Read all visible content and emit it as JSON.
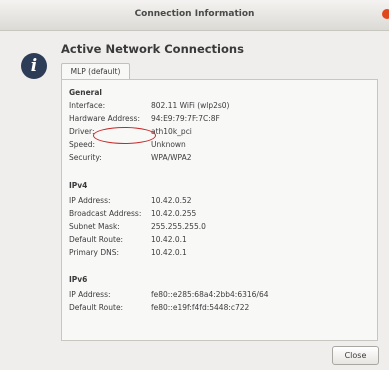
{
  "window": {
    "title": "Connection Information"
  },
  "heading": "Active Network Connections",
  "tab_label": "MLP (default)",
  "general": {
    "title": "General",
    "rows": [
      {
        "key": "Interface:",
        "value": "802.11 WiFi (wlp2s0)"
      },
      {
        "key": "Hardware Address:",
        "value": "94:E9:79:7F:7C:8F"
      },
      {
        "key": "Driver:",
        "value": "ath10k_pci"
      },
      {
        "key": "Speed:",
        "value": "Unknown"
      },
      {
        "key": "Security:",
        "value": "WPA/WPA2"
      }
    ]
  },
  "ipv4": {
    "title": "IPv4",
    "rows": [
      {
        "key": "IP Address:",
        "value": "10.42.0.52"
      },
      {
        "key": "Broadcast Address:",
        "value": "10.42.0.255"
      },
      {
        "key": "Subnet Mask:",
        "value": "255.255.255.0"
      },
      {
        "key": "Default Route:",
        "value": "10.42.0.1"
      },
      {
        "key": "Primary DNS:",
        "value": "10.42.0.1"
      }
    ]
  },
  "ipv6": {
    "title": "IPv6",
    "rows": [
      {
        "key": "IP Address:",
        "value": "fe80::e285:68a4:2bb4:6316/64"
      },
      {
        "key": "Default Route:",
        "value": "fe80::e19f:f4fd:5448:c722"
      }
    ]
  },
  "buttons": {
    "close": "Close"
  },
  "colors": {
    "highlight_ring": "#c62828",
    "close_dot": "#e1471f",
    "info_icon_bg": "#2d3d57"
  },
  "icons": {
    "info": "i"
  }
}
